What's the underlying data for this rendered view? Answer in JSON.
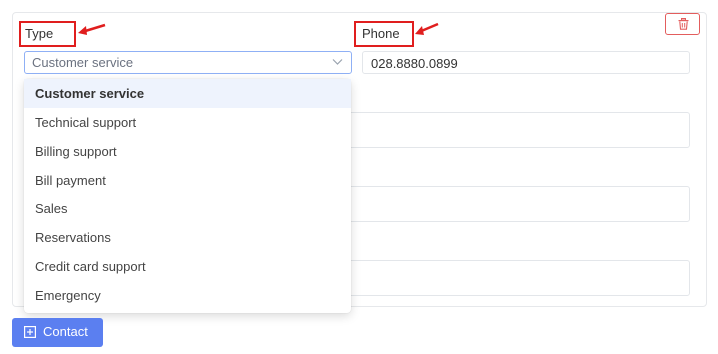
{
  "fields": {
    "type_label": "Type",
    "phone_label": "Phone",
    "type_selected": "Customer service",
    "phone_value": "028.8880.0899"
  },
  "dropdown": {
    "options": [
      "Customer service",
      "Technical support",
      "Billing support",
      "Bill payment",
      "Sales",
      "Reservations",
      "Credit card support",
      "Emergency"
    ],
    "selected_index": 0
  },
  "buttons": {
    "contact_label": "Contact"
  },
  "icons": {
    "delete": "trash-icon",
    "contact": "plus-square-icon",
    "dropdown": "chevron-down-icon"
  },
  "colors": {
    "annotation": "#e01e1e",
    "primary": "#5b7ff0",
    "danger": "#e35d5d",
    "select_border": "#8fb0f5"
  }
}
